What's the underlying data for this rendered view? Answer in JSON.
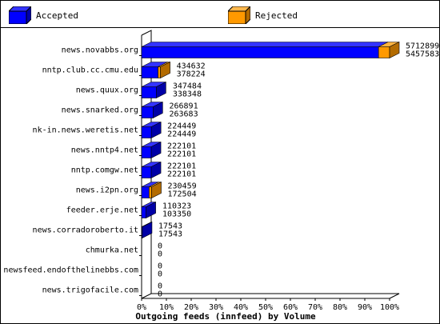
{
  "legend": {
    "accepted_label": "Accepted",
    "rejected_label": "Rejected",
    "accepted_color": "#0000ff",
    "rejected_color": "#ff9900"
  },
  "chart_data": {
    "type": "bar",
    "orientation": "horizontal",
    "title": "",
    "xlabel": "Outgoing feeds (innfeed) by Volume",
    "ylabel": "",
    "xlim": [
      0,
      100
    ],
    "x_ticks": [
      "0%",
      "10%",
      "20%",
      "30%",
      "40%",
      "50%",
      "60%",
      "70%",
      "80%",
      "90%",
      "100%"
    ],
    "grid": false,
    "legend_position": "top",
    "categories": [
      "news.novabbs.org",
      "nntp.club.cc.cmu.edu",
      "news.quux.org",
      "news.snarked.org",
      "nk-in.news.weretis.net",
      "news.nntp4.net",
      "nntp.comgw.net",
      "news.i2pn.org",
      "feeder.erje.net",
      "news.corradoroberto.it",
      "chmurka.net",
      "newsfeed.endofthelinebbs.com",
      "news.trigofacile.com"
    ],
    "series": [
      {
        "name": "Accepted",
        "color": "#0000ff",
        "values": [
          5457583,
          378224,
          338348,
          263683,
          224449,
          222101,
          222101,
          172504,
          103350,
          17543,
          0,
          0,
          0
        ]
      },
      {
        "name": "Rejected",
        "color": "#ff9900",
        "values": [
          5712899,
          434632,
          347484,
          266891,
          224449,
          222101,
          222101,
          230459,
          110323,
          17543,
          0,
          0,
          0
        ]
      }
    ],
    "value_labels_top": [
      "5712899",
      "434632",
      "347484",
      "266891",
      "224449",
      "222101",
      "222101",
      "230459",
      "110323",
      "17543",
      "0",
      "0",
      "0"
    ],
    "value_labels_bottom": [
      "5457583",
      "378224",
      "338348",
      "263683",
      "224449",
      "222101",
      "222101",
      "172504",
      "103350",
      "17543",
      "0",
      "0",
      "0"
    ]
  }
}
